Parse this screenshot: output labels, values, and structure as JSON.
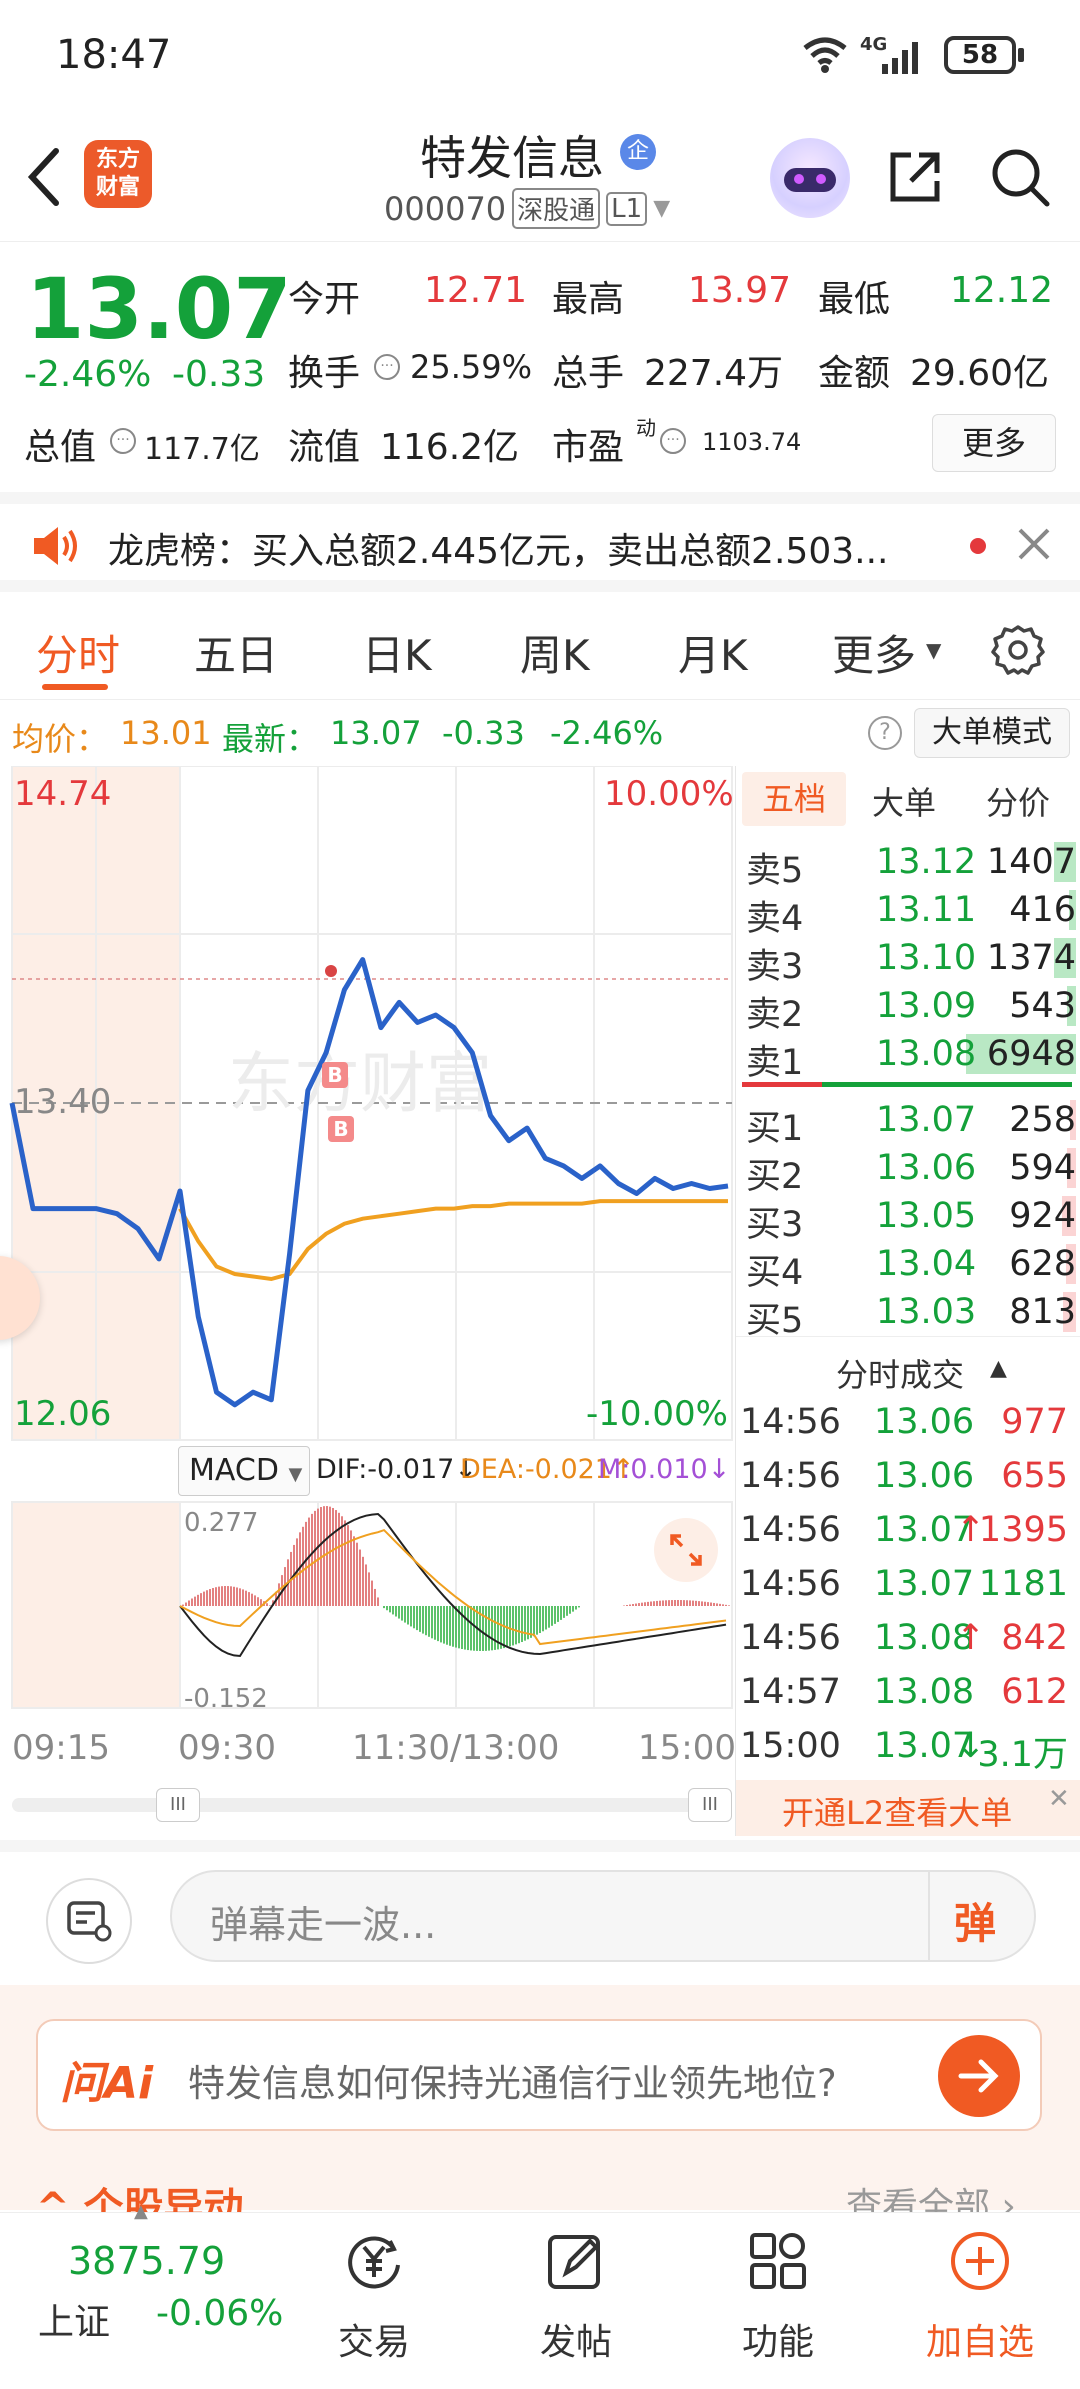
{
  "status": {
    "time": "18:47",
    "network": "4G",
    "battery": "58"
  },
  "header": {
    "logo_text_1": "东方",
    "logo_text_2": "财富",
    "stock_name": "特发信息",
    "enterprise_badge": "企",
    "stock_code": "000070",
    "connect_tag": "深股通",
    "level_tag": "L1"
  },
  "quote": {
    "price": "13.07",
    "change_pct": "-2.46%",
    "change": "-0.33",
    "open_label": "今开",
    "open": "12.71",
    "high_label": "最高",
    "high": "13.97",
    "low_label": "最低",
    "low": "12.12",
    "turnover_label": "换手",
    "turnover": "25.59%",
    "volume_label": "总手",
    "volume": "227.4万",
    "amount_label": "金额",
    "amount": "29.60亿",
    "mcap_label": "总值",
    "mcap": "117.7亿",
    "float_label": "流值",
    "float": "116.2亿",
    "pe_label": "市盈",
    "pe_sup": "动",
    "pe": "1103.74",
    "more_button": "更多"
  },
  "notice": {
    "text": "龙虎榜：买入总额2.445亿元，卖出总额2.503..."
  },
  "tabs": [
    "分时",
    "五日",
    "日K",
    "周K",
    "月K",
    "更多"
  ],
  "infobar": {
    "avg_label": "均价：",
    "avg": "13.01",
    "latest_label": "最新：",
    "latest": "13.07",
    "change": "-0.33",
    "change_pct": "-2.46%",
    "help": "?",
    "mode_button": "大单模式"
  },
  "chart": {
    "y_top": "14.74",
    "y_mid": "13.40",
    "y_bottom": "12.06",
    "pct_top": "10.00%",
    "pct_bottom": "-10.00%",
    "watermark": "东方财富",
    "marker": "B",
    "macd_select": "MACD",
    "dif": "DIF:-0.017↓",
    "dea": "DEA:-0.021↑",
    "m": "M:0.010↓",
    "macd_top": "0.277",
    "macd_bottom": "-0.152",
    "time_labels": [
      "09:15",
      "09:30",
      "11:30/13:00",
      "15:00"
    ],
    "scroll_handle": "III"
  },
  "chart_data": {
    "type": "line",
    "title": "",
    "ylim": [
      12.06,
      14.74
    ],
    "y_reference": 13.4,
    "x_labels": [
      "09:15",
      "09:30",
      "11:30/13:00",
      "15:00"
    ],
    "series": [
      {
        "name": "",
        "color": "#2a62c9",
        "values": [
          13.4,
          12.98,
          12.98,
          12.98,
          12.98,
          12.96,
          12.9,
          12.78,
          13.05,
          12.55,
          12.25,
          12.2,
          12.25,
          12.22,
          12.8,
          13.45,
          13.6,
          13.85,
          13.97,
          13.7,
          13.8,
          13.72,
          13.75,
          13.7,
          13.6,
          13.35,
          13.25,
          13.3,
          13.18,
          13.15,
          13.1,
          13.15,
          13.08,
          13.04,
          13.1,
          13.06,
          13.08,
          13.06,
          13.07
        ]
      },
      {
        "name": "",
        "color": "#f0a020",
        "values": [
          null,
          null,
          null,
          null,
          null,
          null,
          null,
          null,
          12.98,
          12.85,
          12.75,
          12.72,
          12.71,
          12.7,
          12.72,
          12.82,
          12.88,
          12.92,
          12.94,
          12.95,
          12.96,
          12.97,
          12.98,
          12.98,
          12.99,
          12.99,
          13.0,
          13.0,
          13.0,
          13.0,
          13.0,
          13.01,
          13.01,
          13.01,
          13.01,
          13.01,
          13.01,
          13.01,
          13.01
        ]
      }
    ]
  },
  "orderbook": {
    "tabs": [
      "五档",
      "大单",
      "分价"
    ],
    "asks": [
      {
        "label": "卖5",
        "price": "13.12",
        "vol": "1407",
        "bar": 0.2
      },
      {
        "label": "卖4",
        "price": "13.11",
        "vol": "416",
        "bar": 0.06
      },
      {
        "label": "卖3",
        "price": "13.10",
        "vol": "1374",
        "bar": 0.2
      },
      {
        "label": "卖2",
        "price": "13.09",
        "vol": "543",
        "bar": 0.08
      },
      {
        "label": "卖1",
        "price": "13.08",
        "vol": "6948",
        "bar": 1.0
      }
    ],
    "bids": [
      {
        "label": "买1",
        "price": "13.07",
        "vol": "258",
        "bar": 0.04
      },
      {
        "label": "买2",
        "price": "13.06",
        "vol": "594",
        "bar": 0.08
      },
      {
        "label": "买3",
        "price": "13.05",
        "vol": "924",
        "bar": 0.13
      },
      {
        "label": "买4",
        "price": "13.04",
        "vol": "628",
        "bar": 0.09
      },
      {
        "label": "买5",
        "price": "13.03",
        "vol": "813",
        "bar": 0.12
      }
    ],
    "trades_title": "分时成交",
    "trades": [
      {
        "time": "14:56",
        "price": "13.06",
        "vol": "977",
        "dir": "",
        "color": "#e4393c"
      },
      {
        "time": "14:56",
        "price": "13.06",
        "vol": "655",
        "dir": "",
        "color": "#e4393c"
      },
      {
        "time": "14:56",
        "price": "13.07",
        "vol": "1395",
        "dir": "↑",
        "color": "#e4393c"
      },
      {
        "time": "14:56",
        "price": "13.07",
        "vol": "1181",
        "dir": "",
        "color": "#14a13a"
      },
      {
        "time": "14:56",
        "price": "13.08",
        "vol": "842",
        "dir": "↑",
        "color": "#e4393c"
      },
      {
        "time": "14:57",
        "price": "13.08",
        "vol": "612",
        "dir": "",
        "color": "#e4393c"
      },
      {
        "time": "15:00",
        "price": "13.07",
        "vol": "3.1万",
        "dir": "↓",
        "color": "#14a13a"
      }
    ],
    "l2_banner": "开通L2查看大单"
  },
  "danmaku": {
    "placeholder": "弹幕走一波...",
    "send_icon": "弹"
  },
  "ai": {
    "logo": "问Ai",
    "question": "特发信息如何保持光通信行业领先地位?"
  },
  "section_peek": {
    "title": "个股异动",
    "more": "查看全部"
  },
  "bottomnav": {
    "index_value": "3875.79",
    "index_name": "上证",
    "index_change": "-0.06%",
    "trade": "交易",
    "post": "发帖",
    "function": "功能",
    "add_watch": "加自选"
  },
  "colors": {
    "up": "#e4393c",
    "down": "#14a13a",
    "accent": "#f05a23",
    "price_line": "#2a62c9",
    "avg_line": "#f0a020"
  }
}
